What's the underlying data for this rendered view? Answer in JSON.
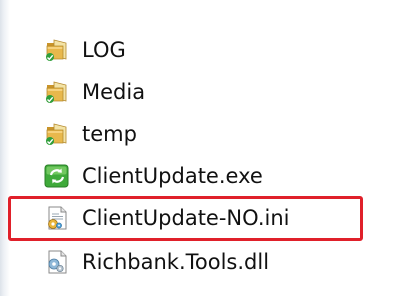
{
  "explorer": {
    "files": [
      {
        "name": "LOG",
        "icon": "folder-icon"
      },
      {
        "name": "Media",
        "icon": "folder-icon"
      },
      {
        "name": "temp",
        "icon": "folder-icon"
      },
      {
        "name": "ClientUpdate.exe",
        "icon": "exe-update-icon"
      },
      {
        "name": "ClientUpdate-NO.ini",
        "icon": "ini-file-icon",
        "highlighted": true
      },
      {
        "name": "Richbank.Tools.dll",
        "icon": "dll-file-icon"
      }
    ],
    "highlight_color": "#e0202a"
  }
}
